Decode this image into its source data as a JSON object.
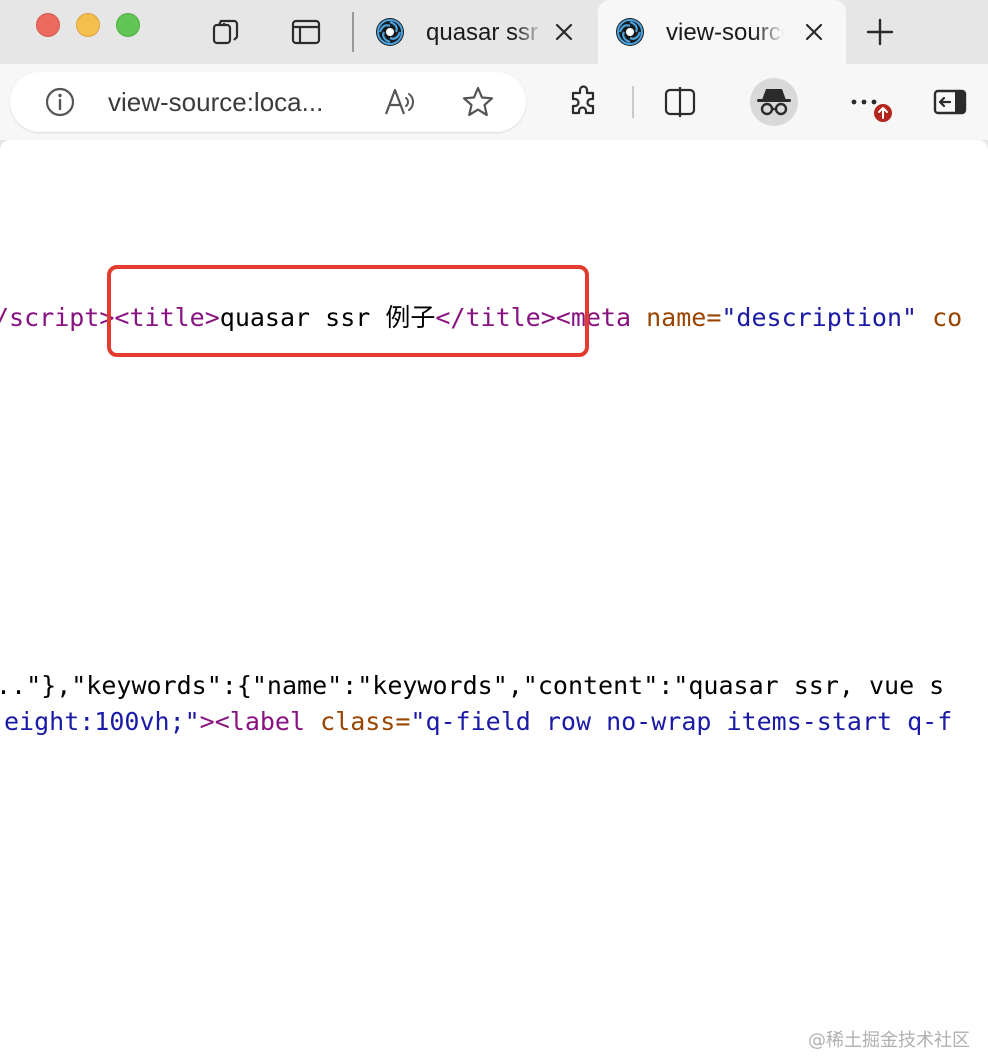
{
  "window": {
    "controls": [
      "close",
      "minimize",
      "maximize"
    ]
  },
  "tabstrip": {
    "left_icons": [
      "workspaces-icon",
      "vertical-tabs-icon"
    ],
    "tabs": [
      {
        "title": "quasar ssr",
        "favicon": "quasar-logo-icon",
        "active": false
      },
      {
        "title": "view-source",
        "favicon": "quasar-logo-icon",
        "active": true
      }
    ],
    "new_tab_icon": "plus-icon"
  },
  "toolbar": {
    "url": "view-source:loca...",
    "icons": [
      "info-icon",
      "read-aloud-icon",
      "favorite-star-icon",
      "extensions-puzzle-icon",
      "split-screen-icon",
      "inprivate-avatar-icon",
      "more-menu-icon",
      "sidebar-toggle-icon"
    ],
    "update_badge_icon": "arrow-up-icon",
    "badge_color": "#b3261e"
  },
  "source": {
    "line1": {
      "t1": "/script>",
      "t2": "<title>",
      "t3": "quasar ssr 例子",
      "t4": "</title>",
      "t5": "<meta",
      "t6": " ",
      "t7": "name=",
      "t8": "\"description\"",
      "t9": " ",
      "t10": "co"
    },
    "line2": {
      "t1": "..\"},\"keywords\":{\"name\":\"keywords\",\"content\":\"quasar ssr, vue s"
    },
    "line3": {
      "t1": "eight:100vh;\"",
      "t2": "><label",
      "t3": " ",
      "t4": "class=",
      "t5": "\"q-field row no-wrap items-start q-f"
    }
  },
  "colors": {
    "tag": "#881280",
    "attribute": "#994500",
    "value": "#1a1aa6",
    "highlight": "#e33b2e"
  },
  "watermark": "@稀土掘金技术社区"
}
